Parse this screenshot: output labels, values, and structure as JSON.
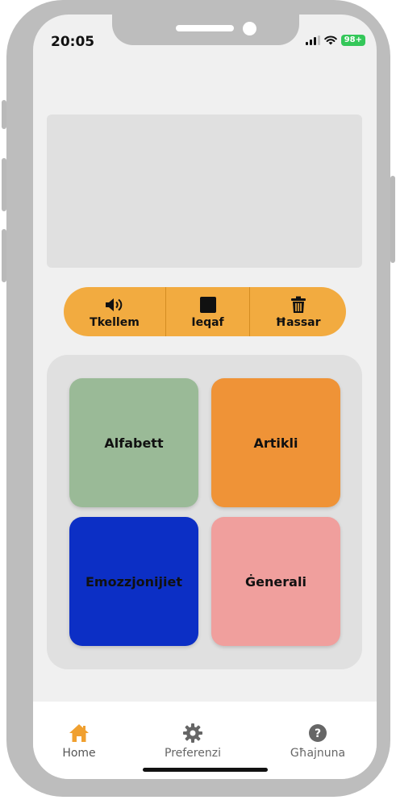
{
  "status_bar": {
    "time": "20:05",
    "battery": "98+"
  },
  "actions": {
    "speak_label": "Tkellem",
    "stop_label": "Ieqaf",
    "clear_label": "Ħassar"
  },
  "categories": [
    {
      "label": "Alfabett",
      "color": "#9aba97"
    },
    {
      "label": "Artikli",
      "color": "#ef9337"
    },
    {
      "label": "Emozzjonijiet",
      "color": "#0c2fc5"
    },
    {
      "label": "Ġenerali",
      "color": "#f09f9d"
    }
  ],
  "tabs": {
    "home": {
      "label": "Home",
      "icon": "home-icon",
      "active": true
    },
    "preferences": {
      "label": "Preferenzi",
      "icon": "gear-icon"
    },
    "help": {
      "label": "Għajnuna",
      "icon": "help-icon"
    }
  },
  "colors": {
    "accent": "#f2ab40",
    "home_active": "#f0a030"
  }
}
